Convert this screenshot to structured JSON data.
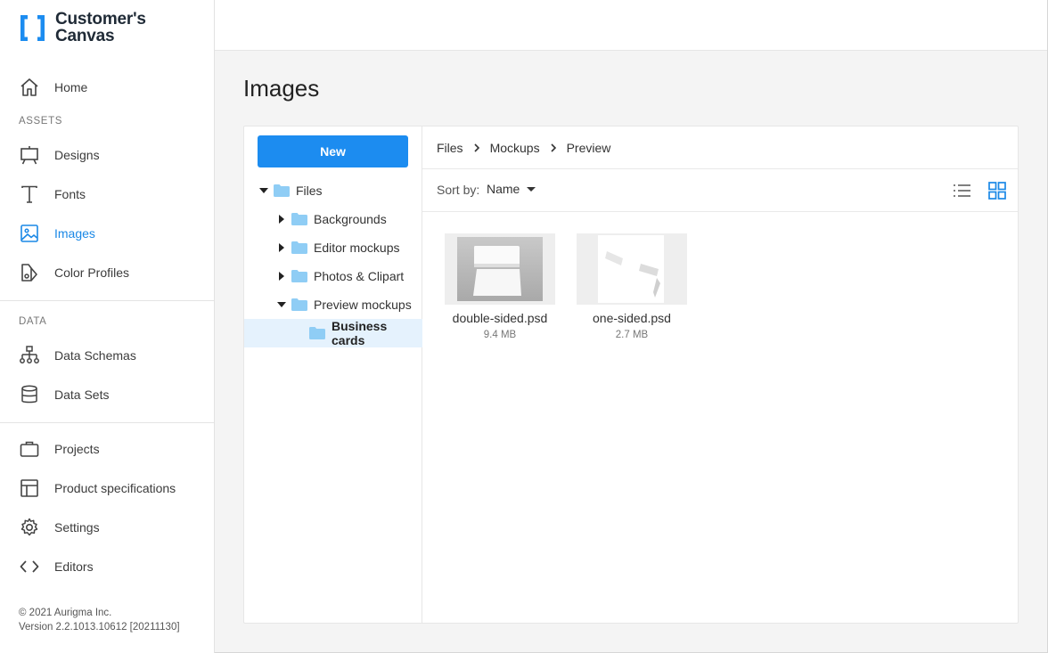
{
  "app": {
    "logo_line1": "Customer's",
    "logo_line2": "Canvas",
    "accent_color": "#1a88e6"
  },
  "sidebar": {
    "home": {
      "label": "Home",
      "icon": "home-icon"
    },
    "assets_section": "ASSETS",
    "assets": [
      {
        "label": "Designs",
        "icon": "easel-icon"
      },
      {
        "label": "Fonts",
        "icon": "text-icon"
      },
      {
        "label": "Images",
        "icon": "image-icon",
        "active": true
      },
      {
        "label": "Color Profiles",
        "icon": "palette-icon"
      }
    ],
    "data_section": "DATA",
    "data": [
      {
        "label": "Data Schemas",
        "icon": "schema-icon"
      },
      {
        "label": "Data Sets",
        "icon": "database-icon"
      }
    ],
    "other": [
      {
        "label": "Projects",
        "icon": "briefcase-icon"
      },
      {
        "label": "Product specifications",
        "icon": "layout-icon"
      },
      {
        "label": "Settings",
        "icon": "gear-icon"
      },
      {
        "label": "Editors",
        "icon": "code-icon"
      }
    ],
    "copyright": "© 2021 Aurigma Inc.",
    "version": "Version 2.2.1013.10612 [20211130]"
  },
  "page": {
    "title": "Images"
  },
  "tree": {
    "new_label": "New",
    "items": [
      {
        "label": "Files",
        "expanded": true
      },
      {
        "label": "Backgrounds",
        "expanded": false
      },
      {
        "label": "Editor mockups",
        "expanded": false
      },
      {
        "label": "Photos & Clipart",
        "expanded": false
      },
      {
        "label": "Preview mockups",
        "expanded": true
      },
      {
        "label": "Business cards",
        "selected": true
      }
    ]
  },
  "breadcrumb": [
    "Files",
    "Mockups",
    "Preview"
  ],
  "toolbar": {
    "sort_label": "Sort by:",
    "sort_value": "Name"
  },
  "files": [
    {
      "name": "double-sided.psd",
      "size": "9.4 MB"
    },
    {
      "name": "one-sided.psd",
      "size": "2.7 MB"
    }
  ]
}
